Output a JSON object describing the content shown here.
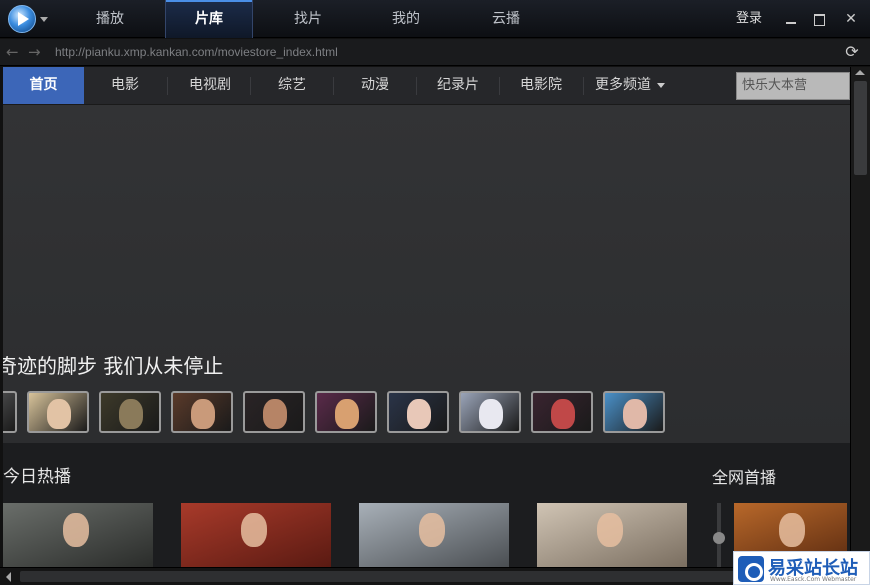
{
  "title_bar": {
    "tabs": [
      {
        "label": "播放"
      },
      {
        "label": "片库"
      },
      {
        "label": "找片"
      },
      {
        "label": "我的"
      },
      {
        "label": "云播"
      }
    ],
    "active_tab": "片库",
    "login_label": "登录",
    "close_glyph": "✕"
  },
  "address_bar": {
    "back_icon": "back-arrow-icon",
    "forward_icon": "forward-arrow-icon",
    "url": "http://pianku.xmp.kankan.com/moviestore_index.html",
    "refresh_glyph": "⟳"
  },
  "channel_nav": {
    "items": [
      {
        "label": "首页"
      },
      {
        "label": "电影"
      },
      {
        "label": "电视剧"
      },
      {
        "label": "综艺"
      },
      {
        "label": "动漫"
      },
      {
        "label": "纪录片"
      },
      {
        "label": "电影院"
      },
      {
        "label": "更多频道"
      }
    ],
    "active": "首页",
    "search_value": "快乐大本营"
  },
  "banner": {
    "slogan": "奇迹的脚步 我们从未停止",
    "thumbnails": [
      {
        "name": "thumb-0",
        "skin": "#b9a08a",
        "bg": "#6d6e70"
      },
      {
        "name": "thumb-1",
        "skin": "#e2c3a5",
        "bg": "#d8c39a"
      },
      {
        "name": "thumb-2",
        "skin": "#8a7a5a",
        "bg": "#3d3a2a"
      },
      {
        "name": "thumb-3",
        "skin": "#c99a7a",
        "bg": "#5a3a2a"
      },
      {
        "name": "thumb-4",
        "skin": "#b68466",
        "bg": "#2a2426"
      },
      {
        "name": "thumb-5",
        "skin": "#d8a070",
        "bg": "#5a2a4a"
      },
      {
        "name": "thumb-6",
        "skin": "#e8c8b8",
        "bg": "#2a3448"
      },
      {
        "name": "thumb-7",
        "skin": "#e8e8f0",
        "bg": "#9aa4b8"
      },
      {
        "name": "thumb-8",
        "skin": "#c04848",
        "bg": "#3a2430"
      },
      {
        "name": "thumb-9",
        "skin": "#e0b8a8",
        "bg": "#4a90c8"
      }
    ]
  },
  "sections": {
    "hot_today": "今日热播",
    "premiere": "全网首播",
    "posters": [
      {
        "name": "poster-1",
        "c1": "#6a6e6a",
        "c2": "#2a2c2a"
      },
      {
        "name": "poster-2",
        "c1": "#a83a2a",
        "c2": "#5a1a12"
      },
      {
        "name": "poster-3",
        "c1": "#a8b0b8",
        "c2": "#4a4e52"
      },
      {
        "name": "poster-4",
        "c1": "#d0c4b4",
        "c2": "#7a6e60"
      },
      {
        "name": "poster-5",
        "c1": "#b8682a",
        "c2": "#5a2a10"
      }
    ]
  },
  "watermark": {
    "text": "易采站长站",
    "sub": "Www.Easck.Com  Webmaster"
  },
  "colors": {
    "accent": "#3c66b8",
    "tab_highlight": "#4a8fe8"
  }
}
